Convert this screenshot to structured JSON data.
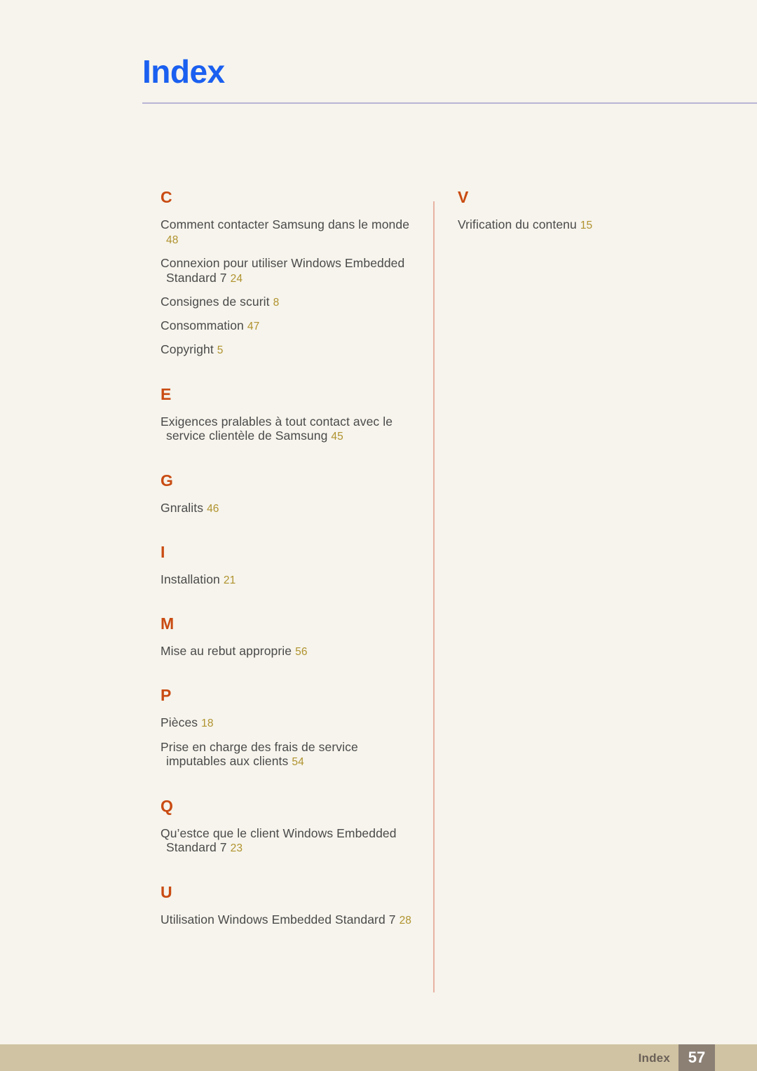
{
  "header": {
    "title": "Index"
  },
  "index": {
    "columns": [
      {
        "groups": [
          {
            "letter": "C",
            "entries": [
              {
                "text": "Comment contacter Samsung dans le monde",
                "page": "48"
              },
              {
                "text": "Connexion pour utiliser Windows Embedded Standard 7",
                "page": "24"
              },
              {
                "text": "Consignes de scurit",
                "page": "8"
              },
              {
                "text": "Consommation",
                "page": "47"
              },
              {
                "text": "Copyright",
                "page": "5"
              }
            ]
          },
          {
            "letter": "E",
            "entries": [
              {
                "text": "Exigences pralables à tout contact avec le service clientèle de Samsung",
                "page": "45"
              }
            ]
          },
          {
            "letter": "G",
            "entries": [
              {
                "text": "Gnralits",
                "page": "46"
              }
            ]
          },
          {
            "letter": "I",
            "entries": [
              {
                "text": "Installation",
                "page": "21"
              }
            ]
          },
          {
            "letter": "M",
            "entries": [
              {
                "text": "Mise au rebut approprie",
                "page": "56"
              }
            ]
          },
          {
            "letter": "P",
            "entries": [
              {
                "text": "Pièces",
                "page": "18"
              },
              {
                "text": "Prise en charge des frais de service imputables aux clients",
                "page": "54"
              }
            ]
          },
          {
            "letter": "Q",
            "entries": [
              {
                "text": "Qu’estce que le client Windows Embedded Standard 7",
                "page": "23"
              }
            ]
          },
          {
            "letter": "U",
            "entries": [
              {
                "text": "Utilisation Windows Embedded Standard 7",
                "page": "28"
              }
            ]
          }
        ]
      },
      {
        "groups": [
          {
            "letter": "V",
            "entries": [
              {
                "text": "Vrification du contenu",
                "page": "15"
              }
            ]
          }
        ]
      }
    ]
  },
  "footer": {
    "label": "Index",
    "page_number": "57"
  },
  "colors": {
    "page_background": "#f6f4ec",
    "title": "#1a5ff0",
    "title_rule": "#b9b5d6",
    "letter_heading": "#c94b12",
    "entry_text": "#4a4a4a",
    "page_number": "#b0922e",
    "column_rule": "#e8b3a4",
    "footer_bar": "#d0c3a3",
    "footer_label": "#6b6158",
    "footer_box": "#8c8075"
  }
}
